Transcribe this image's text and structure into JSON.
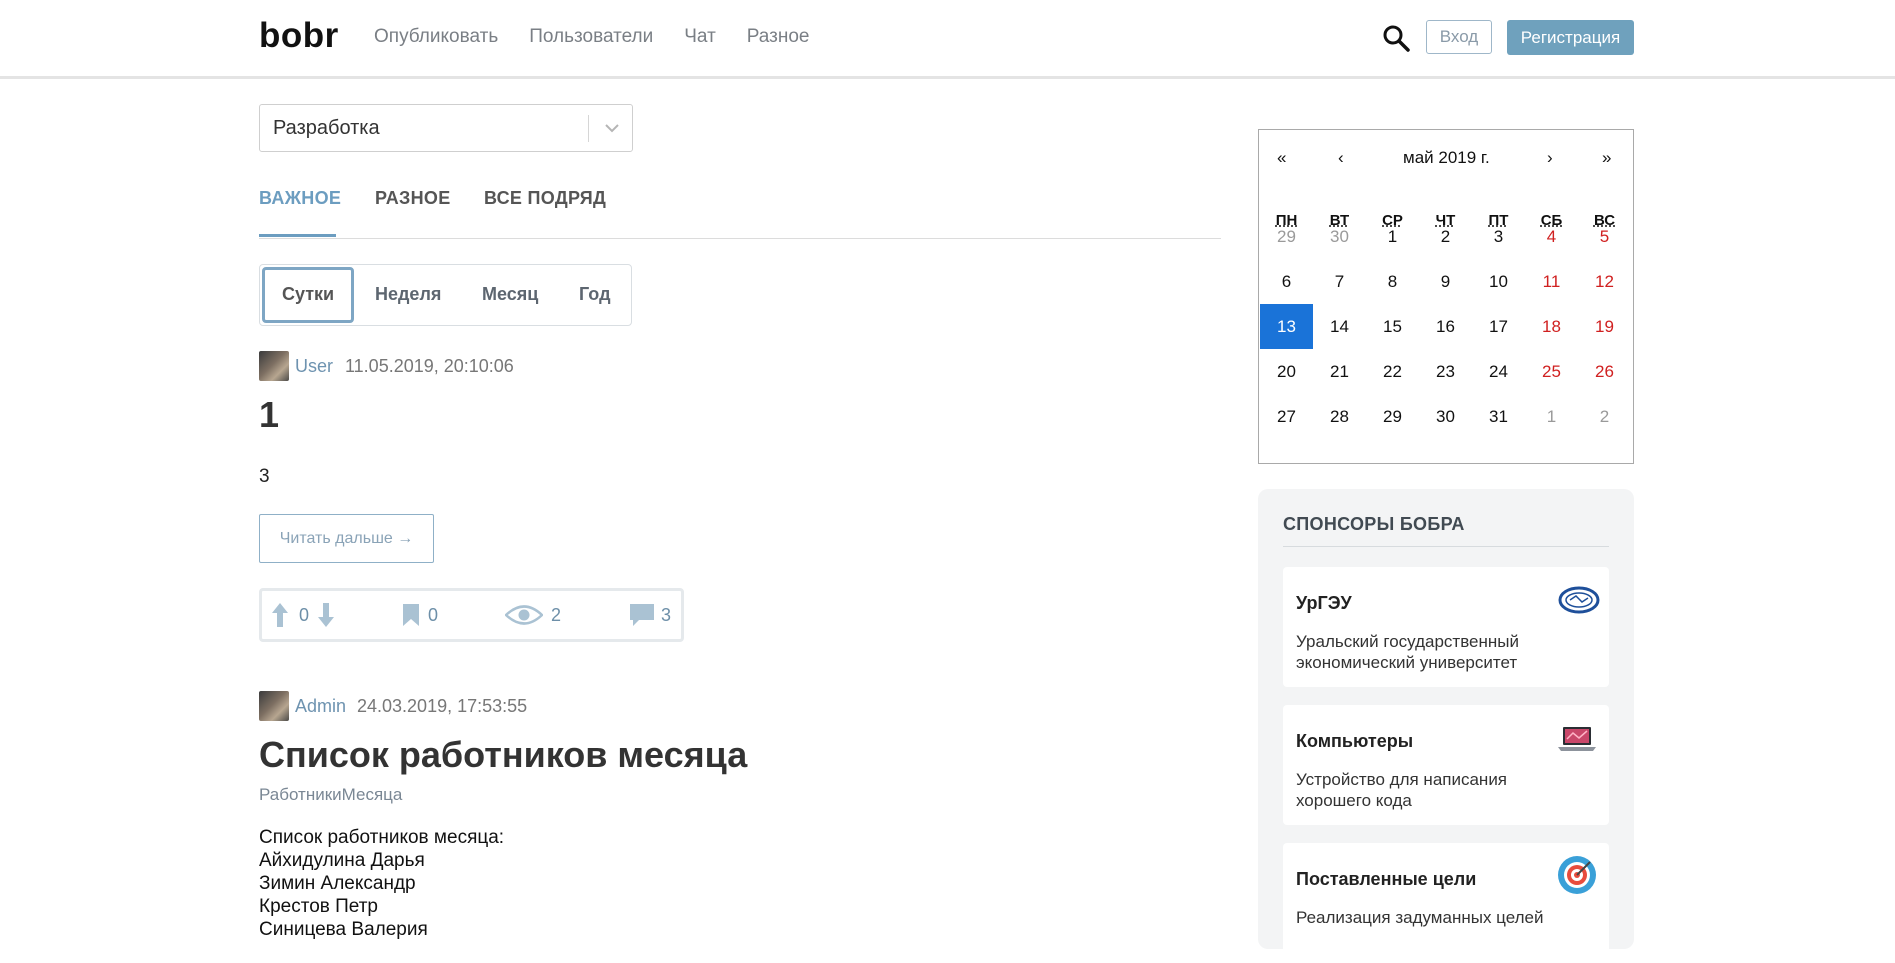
{
  "header": {
    "logo": "bobr",
    "nav": [
      "Опубликовать",
      "Пользователи",
      "Чат",
      "Разное"
    ],
    "login": "Вход",
    "register": "Регистрация"
  },
  "filter": {
    "category": "Разработка",
    "tabs": [
      "ВАЖНОЕ",
      "РАЗНОЕ",
      "ВСЕ ПОДРЯД"
    ],
    "active_tab": "ВАЖНОЕ",
    "periods": [
      "Сутки",
      "Неделя",
      "Месяц",
      "Год"
    ],
    "active_period": "Сутки"
  },
  "posts": [
    {
      "author": "User",
      "date": "11.05.2019, 20:10:06",
      "title": "1",
      "text": "3",
      "read_more": "Читать дальше →",
      "rating": "0",
      "bookmarks": "0",
      "views": "2",
      "comments": "3"
    },
    {
      "author": "Admin",
      "date": "24.03.2019, 17:53:55",
      "title": "Список работников месяца",
      "tag": "РаботникиМесяца",
      "lines": [
        "Список работников месяца:",
        "Айхидулина Дарья",
        "Зимин Александр",
        "Крестов Петр",
        "Синицева Валерия"
      ]
    }
  ],
  "calendar": {
    "prev_year": "«",
    "prev_month": "‹",
    "month_label": "май 2019 г.",
    "next_month": "›",
    "next_year": "»",
    "weekdays": [
      "ПН",
      "ВТ",
      "СР",
      "ЧТ",
      "ПТ",
      "СБ",
      "ВС"
    ],
    "weeks": [
      [
        "29",
        "30",
        "1",
        "2",
        "3",
        "4",
        "5"
      ],
      [
        "6",
        "7",
        "8",
        "9",
        "10",
        "11",
        "12"
      ],
      [
        "13",
        "14",
        "15",
        "16",
        "17",
        "18",
        "19"
      ],
      [
        "20",
        "21",
        "22",
        "23",
        "24",
        "25",
        "26"
      ],
      [
        "27",
        "28",
        "29",
        "30",
        "31",
        "1",
        "2"
      ]
    ],
    "today": "13",
    "colors": {
      "today_bg": "#1a73d8",
      "weekend": "#d02020",
      "other_month": "#9a9a9a"
    }
  },
  "sponsors": {
    "title": "СПОНСОРЫ БОБРА",
    "items": [
      {
        "name": "УрГЭУ",
        "desc": "Уральский государственный экономический университет",
        "icon": "university-logo-icon"
      },
      {
        "name": "Компьютеры",
        "desc": "Устройство для написания хорошего кода",
        "icon": "laptop-icon"
      },
      {
        "name": "Поставленные цели",
        "desc": "Реализация задуманных целей",
        "icon": "target-icon"
      }
    ]
  }
}
